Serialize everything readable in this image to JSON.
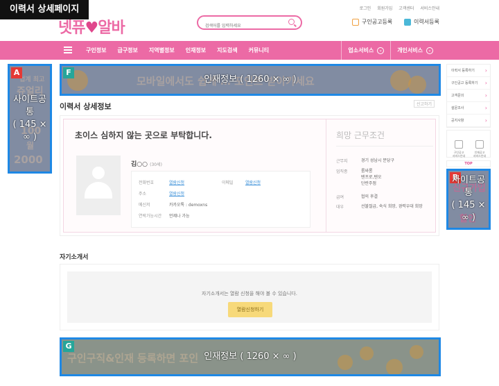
{
  "page_tag": "이력서 상세페이지",
  "top_links": [
    "로그인",
    "회원가입",
    "고객센터",
    "서비스안내"
  ],
  "logo": {
    "part1": "넷퓨",
    "heart": "♥",
    "part2": "알바"
  },
  "search": {
    "placeholder": "검색어를 입력하세요"
  },
  "header_buttons": {
    "job_post": "구인공고등록",
    "resume": "이력서등록"
  },
  "nav": {
    "items": [
      "구인정보",
      "급구정보",
      "지역별정보",
      "인재정보",
      "지도검색",
      "커뮤니티"
    ],
    "right": [
      "업소서비스",
      "개인서비스"
    ]
  },
  "ads": {
    "A": {
      "tag": "A",
      "label": "사이트공통",
      "size": "( 145 × ∞ )",
      "bg_lines": [
        "업계 최고",
        "쥬얼리",
        "100",
        "월",
        "2000"
      ]
    },
    "B": {
      "tag": "B",
      "label": "사이트공통",
      "size": "( 145 × ∞ )",
      "bg_lines": [
        "신규가입",
        "할인"
      ]
    },
    "F": {
      "tag": "F",
      "label": "인재정보 ( 1260 × ∞ )",
      "bg": "모바일에서도 쉽게 … 포인트 받아가세요"
    },
    "G": {
      "tag": "G",
      "label": "인재정보 ( 1260 × ∞ )",
      "bg": "구인구직&인재 등록하면 포인"
    }
  },
  "section_title": "이력서 상세정보",
  "report_link": "신고하기",
  "resume": {
    "headline": "초이스 심하지 않는 곳으로 부탁합니다.",
    "name": "김○○",
    "age": "(30세)",
    "contacts": [
      {
        "label": "전화번호",
        "value": "열람신청",
        "link": true
      },
      {
        "label": "이메일",
        "value": "열람신청",
        "link": true
      },
      {
        "label": "주소",
        "value": "열람신청",
        "link": true
      },
      {
        "label": "메신저",
        "value": "카카오톡 : demoxns",
        "link": false
      },
      {
        "label": "연락가능시간",
        "value": "언제나 가능",
        "link": false
      }
    ],
    "hope_title": "희망 근무조건",
    "hope_rows": [
      {
        "label": "근무지",
        "value": "경기 성남시 분당구"
      },
      {
        "label": "업직종",
        "value": "룸싸롱\n텐프로,텐오\n단란주점"
      },
      {
        "label": "급여",
        "value": "협의 후결"
      },
      {
        "label": "대우",
        "value": "선불절급, 숙식 희망, 경력우대 희망"
      }
    ]
  },
  "intro": {
    "title": "자기소개서",
    "message": "자기소개서는 열람 신청을 해야 볼 수 있습니다.",
    "button": "열람신청하기"
  },
  "side": {
    "menu": [
      "이력서 등록하기",
      "구인공고 등록하기",
      "고객문의",
      "설문조사",
      "공지사항"
    ],
    "icons": [
      "구인공고\n서비스안내",
      "인재공고\n서비스안내"
    ],
    "top": "TOP"
  }
}
